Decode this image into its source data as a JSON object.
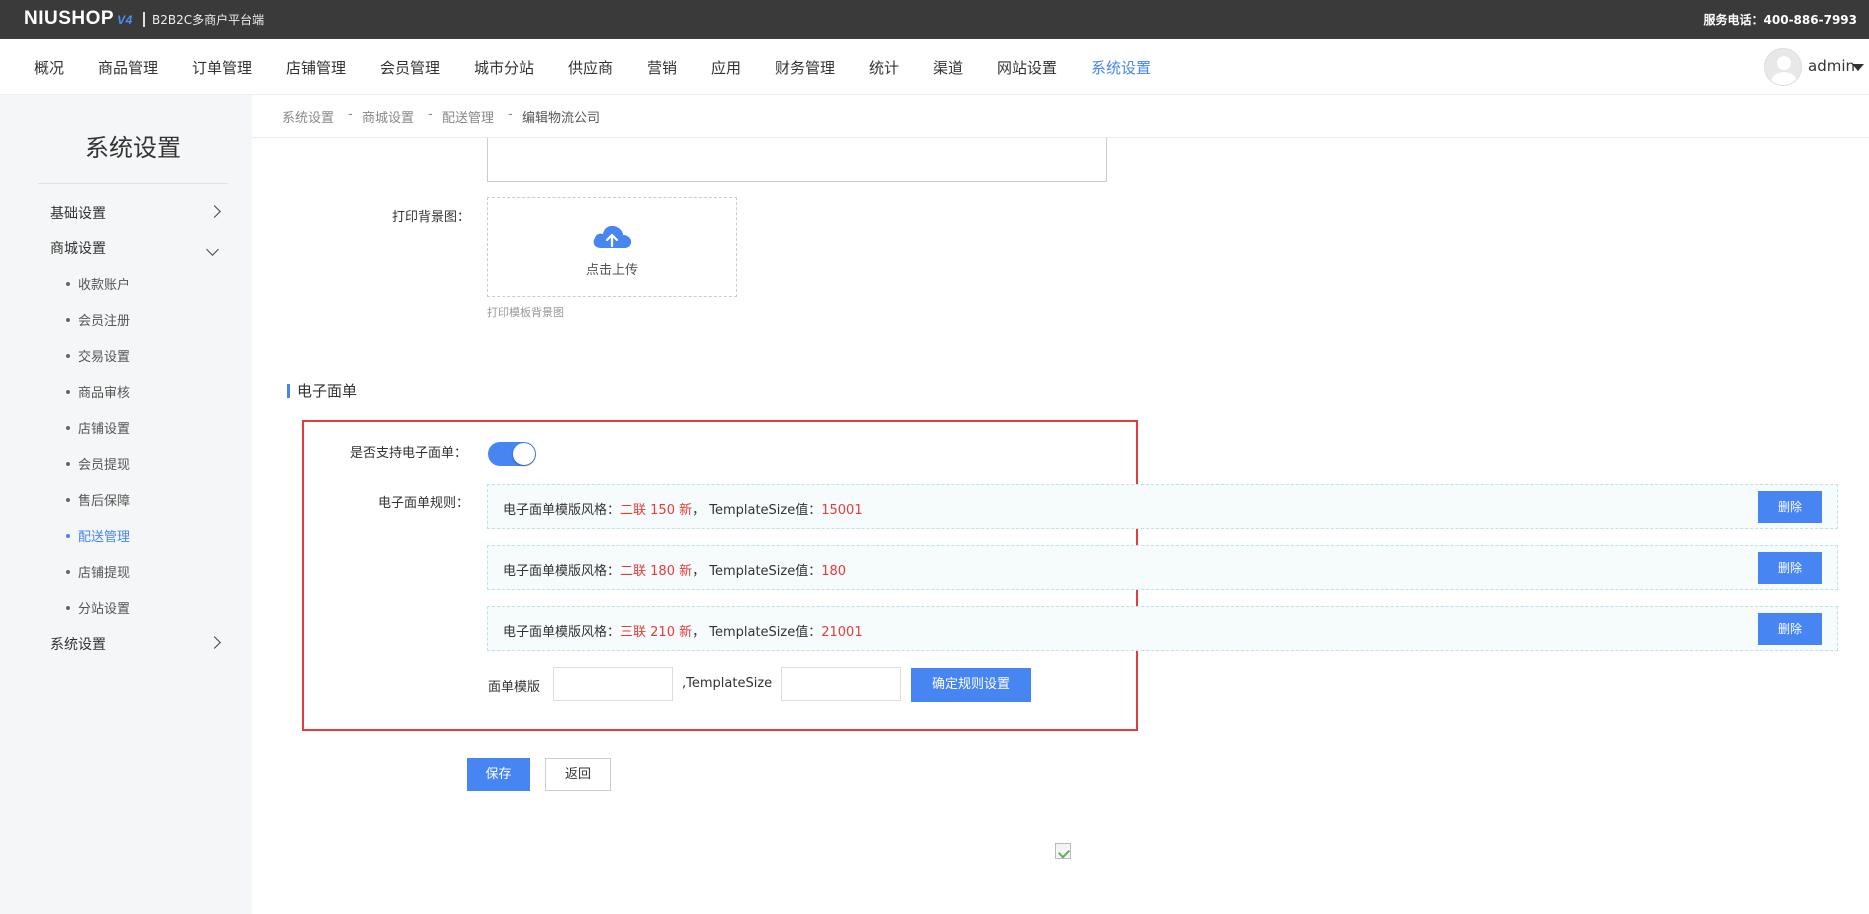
{
  "topbar": {
    "logo": "NIUSHOP",
    "logo_version": "V4",
    "subtitle": "B2B2C多商户平台端",
    "service_phone": "服务电话：400-886-7993"
  },
  "nav": {
    "items": [
      "概况",
      "商品管理",
      "订单管理",
      "店铺管理",
      "会员管理",
      "城市分站",
      "供应商",
      "营销",
      "应用",
      "财务管理",
      "统计",
      "渠道",
      "网站设置",
      "系统设置"
    ],
    "active": "系统设置",
    "user": "admin"
  },
  "sidebar": {
    "title": "系统设置",
    "groups": [
      {
        "label": "基础设置",
        "expanded": false
      },
      {
        "label": "商城设置",
        "expanded": true
      },
      {
        "label": "系统设置",
        "expanded": false
      }
    ],
    "sub_items": [
      "收款账户",
      "会员注册",
      "交易设置",
      "商品审核",
      "店铺设置",
      "会员提现",
      "售后保障",
      "配送管理",
      "店铺提现",
      "分站设置"
    ],
    "active_sub": "配送管理"
  },
  "breadcrumb": [
    "系统设置",
    "商城设置",
    "配送管理",
    "编辑物流公司"
  ],
  "breadcrumb_separator": "-",
  "form": {
    "print_bg_label": "打印背景图：",
    "upload_text": "点击上传",
    "upload_hint": "打印模板背景图",
    "section_title": "电子面单",
    "support_label": "是否支持电子面单：",
    "support_enabled": true,
    "rules_label": "电子面单规则：",
    "rules": [
      {
        "prefix": "电子面单模版风格：",
        "style": "二联 150 新",
        "mid": "，  TemplateSize值：",
        "size": "15001",
        "delete": "删除"
      },
      {
        "prefix": "电子面单模版风格：",
        "style": "二联 180 新",
        "mid": "，  TemplateSize值：",
        "size": "180",
        "delete": "删除"
      },
      {
        "prefix": "电子面单模版风格：",
        "style": "三联 210 新",
        "mid": "，  TemplateSize值：",
        "size": "21001",
        "delete": "删除"
      }
    ],
    "template_label": "面单模版",
    "template_value": "",
    "templatesize_label": ",TemplateSize",
    "templatesize_value": "",
    "confirm_button": "确定规则设置",
    "save_button": "保存",
    "back_button": "返回"
  },
  "colors": {
    "primary": "#4685f2",
    "highlight": "#e63b3b",
    "topbar": "#3a3a3a",
    "sidebar_bg": "#f5f6f7"
  }
}
